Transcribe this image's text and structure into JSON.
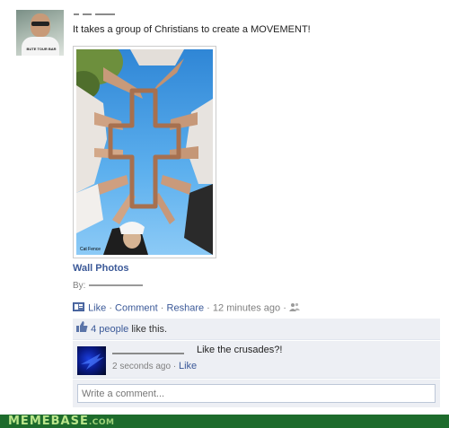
{
  "post": {
    "status": "It takes a group of Christians to create a MOVEMENT!",
    "shirt_text": "BUTE TOUR BAR",
    "photo_caption": "Cat Fence",
    "album_link": "Wall Photos",
    "by_label": "By:",
    "actions": {
      "like": "Like",
      "comment": "Comment",
      "reshare": "Reshare",
      "sep": "·",
      "timestamp": "12 minutes ago"
    }
  },
  "feedback": {
    "likes_count_link": "4 people",
    "likes_suffix": " like this.",
    "comment": {
      "text": "Like the crusades?!",
      "time": "2 seconds ago",
      "sep": "·",
      "like": "Like"
    },
    "write_placeholder": "Write a comment..."
  },
  "watermark": {
    "brand": "MEMEBASE",
    "tld": ".COM"
  },
  "colors": {
    "link": "#3b5998",
    "feedback_bg": "#edeff4",
    "watermark_bg": "#1d6b2c"
  },
  "icons": [
    "user-avatar",
    "like-icon",
    "thumbs-up-icon",
    "share-people-icon",
    "comment-avatar"
  ]
}
